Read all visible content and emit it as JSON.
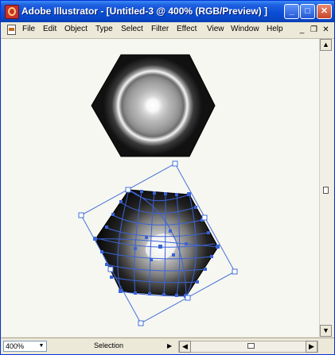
{
  "window": {
    "title": "Adobe Illustrator - [Untitled-3 @ 400% (RGB/Preview) ]",
    "controls": {
      "minimize": "_",
      "maximize": "□",
      "close": "✕"
    }
  },
  "menubar": {
    "items": [
      "File",
      "Edit",
      "Object",
      "Type",
      "Select",
      "Filter",
      "Effect",
      "View",
      "Window",
      "Help"
    ],
    "doc_controls": {
      "minimize": "_",
      "restore": "❐",
      "close": "✕"
    }
  },
  "statusbar": {
    "zoom": "400%",
    "status_text": "Selection"
  },
  "colors": {
    "title_bar": "#0a4fd6",
    "selection": "#4670d8",
    "canvas": "#f6f7f1"
  },
  "icons": [
    "app-logo-icon",
    "document-icon",
    "scroll-up-icon",
    "scroll-down-icon",
    "dropdown-arrow-icon",
    "scroll-left-icon",
    "scroll-right-icon"
  ]
}
